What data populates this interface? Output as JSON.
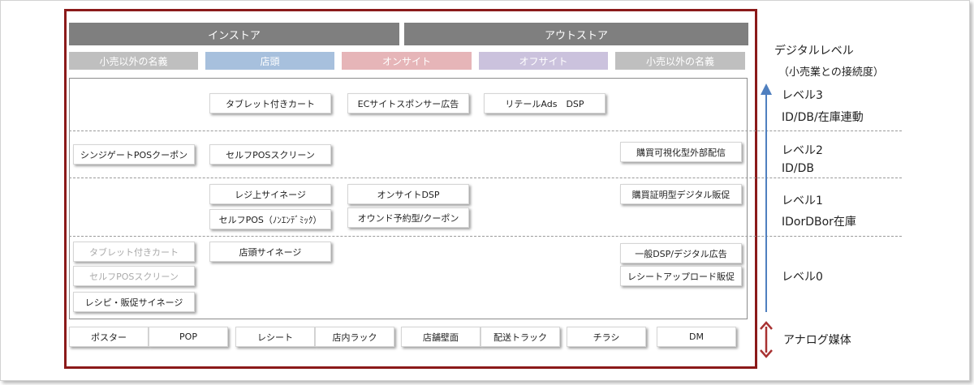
{
  "headers": {
    "instore": "インストア",
    "outstore": "アウトストア"
  },
  "subheaders": [
    {
      "label": "小売以外の名義",
      "color": "#bfbfbf"
    },
    {
      "label": "店頭",
      "color": "#a7c0dd"
    },
    {
      "label": "オンサイト",
      "color": "#e6b5b8"
    },
    {
      "label": "オフサイト",
      "color": "#cbc2dd"
    },
    {
      "label": "小売以外の名義",
      "color": "#bfbfbf"
    }
  ],
  "level3_items": [
    "タブレット付きカート",
    "ECサイトスポンサー広告",
    "リテールAds　DSP"
  ],
  "level2_items": [
    "シンジゲートPOSクーポン",
    "セルフPOSスクリーン",
    "購買可視化型外部配信"
  ],
  "level1_items": [
    "レジ上サイネージ",
    "オンサイトDSP",
    "購買証明型デジタル販促",
    "セルフPOS（ﾉﾝｴﾝﾃﾞﾐｯｸ）",
    "オウンド予約型/クーポン"
  ],
  "level0_items": [
    "タブレット付きカート",
    "セルフPOSスクリーン",
    "レシピ・販促サイネージ",
    "店頭サイネージ",
    "一般DSP/デジタル広告",
    "レシートアップロード販促"
  ],
  "analog_items": [
    "ポスター",
    "POP",
    "レシート",
    "店内ラック",
    "店舗壁面",
    "配送トラック",
    "チラシ",
    "DM"
  ],
  "right_panel": {
    "title": "デジタルレベル",
    "subtitle": "（小売業との接続度）",
    "level3": {
      "name": "レベル3",
      "desc": "ID/DB/在庫連動"
    },
    "level2": {
      "name": "レベル2",
      "desc": "ID/DB"
    },
    "level1": {
      "name": "レベル1",
      "desc": "IDorDBor在庫"
    },
    "level0": {
      "name": "レベル0"
    },
    "analog": "アナログ媒体"
  },
  "colors": {
    "frame_red": "#8b1a1a",
    "arrow_blue": "#4f7fbf",
    "arrow_red": "#a83232",
    "header_gray": "#7f7f7f"
  }
}
